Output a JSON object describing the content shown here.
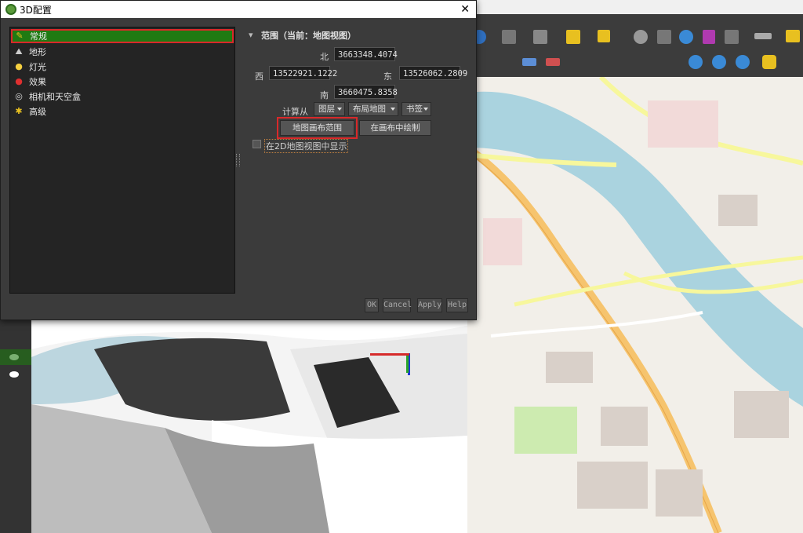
{
  "dialog": {
    "title": "3D配置",
    "close_glyph": "✕",
    "nav_items": [
      {
        "label": "常规",
        "icon": "general-icon"
      },
      {
        "label": "地形",
        "icon": "terrain-icon"
      },
      {
        "label": "灯光",
        "icon": "light-bulb-icon"
      },
      {
        "label": "效果",
        "icon": "effects-icon"
      },
      {
        "label": "相机和天空盒",
        "icon": "camera-icon"
      },
      {
        "label": "高级",
        "icon": "advanced-icon"
      }
    ],
    "extent": {
      "section_title": "范围（当前：地图视图）",
      "north_label": "北",
      "north_value": "3663348.4074",
      "west_label": "西",
      "west_value": "13522921.1222",
      "east_label": "东",
      "east_value": "13526062.2809",
      "south_label": "南",
      "south_value": "3660475.8358",
      "calc_from_label": "计算从",
      "layer_combo": "图层",
      "layout_combo": "布局地图",
      "bookmark_combo": "书签",
      "map_canvas_extent_button": "地图画布范围",
      "draw_on_canvas_button": "在画布中绘制",
      "show_in_2d_label": "在2D地图视图中显示"
    },
    "buttons": {
      "ok": "OK",
      "cancel": "Cancel",
      "apply": "Apply",
      "help": "Help"
    }
  },
  "colors": {
    "selected_nav": "#1f7a12",
    "highlight_red": "#d9292a"
  }
}
